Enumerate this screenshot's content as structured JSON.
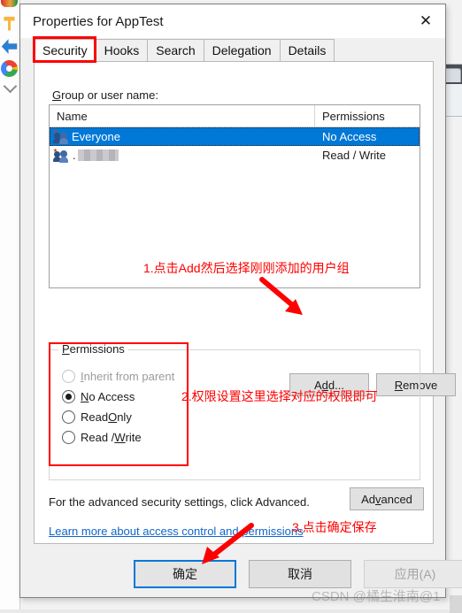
{
  "window": {
    "title": "Properties for AppTest",
    "close_icon": "close-icon"
  },
  "tabs": [
    {
      "label": "Security",
      "active": true
    },
    {
      "label": "Hooks",
      "active": false
    },
    {
      "label": "Search",
      "active": false
    },
    {
      "label": "Delegation",
      "active": false
    },
    {
      "label": "Details",
      "active": false
    }
  ],
  "security": {
    "group_label_underlined": "G",
    "group_label_rest": "roup or user name:",
    "list": {
      "columns": [
        "Name",
        "Permissions"
      ],
      "rows": [
        {
          "name": "Everyone",
          "permission": "No Access",
          "selected": true,
          "redacted": false
        },
        {
          "name": ".",
          "permission": "Read / Write",
          "selected": false,
          "redacted": true
        }
      ]
    },
    "buttons": {
      "add": {
        "pre": "A",
        "key": "d",
        "post": "d..."
      },
      "remove": {
        "key": "R",
        "post": "emove"
      }
    },
    "permissions_group": {
      "legend_key": "P",
      "legend_rest": "ermissions",
      "options": [
        {
          "pre": "",
          "key": "I",
          "post": "nherit from parent",
          "checked": false,
          "disabled": true
        },
        {
          "pre": "",
          "key": "N",
          "post": "o Access",
          "checked": true,
          "disabled": false
        },
        {
          "pre": "Read ",
          "key": "O",
          "post": "nly",
          "checked": false,
          "disabled": false
        },
        {
          "pre": "Read / ",
          "key": "W",
          "post": "rite",
          "checked": false,
          "disabled": false
        }
      ]
    },
    "advanced_text": "For the advanced security settings, click Advanced.",
    "advanced_button": {
      "pre": "Ad",
      "key": "v",
      "post": "anced"
    },
    "learn_more_link": "Learn more about access control and permissions"
  },
  "footer": {
    "ok": "确定",
    "cancel": "取消",
    "apply": "应用(A)"
  },
  "annotations": [
    {
      "id": "annot1",
      "text": "1.点击Add然后选择刚刚添加的用户组"
    },
    {
      "id": "annot2",
      "text": "2.权限设置这里选择对应的权限即可"
    },
    {
      "id": "annot3",
      "text": "3.点击确定保存"
    }
  ],
  "watermark": "CSDN @橘生淮南@1",
  "colors": {
    "annotation_red": "#ff0000",
    "selection_blue": "#0078d7",
    "link_blue": "#1166cc"
  }
}
